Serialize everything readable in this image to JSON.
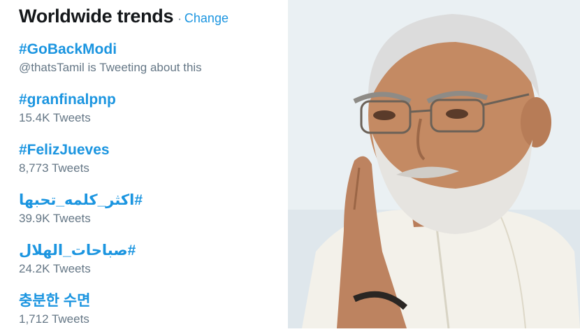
{
  "trends_panel": {
    "title": "Worldwide trends",
    "separator": "·",
    "change_label": "Change",
    "items": [
      {
        "name": "#GoBackModi",
        "meta": "@thatsTamil is Tweeting about this"
      },
      {
        "name": "#granfinalpnp",
        "meta": "15.4K Tweets"
      },
      {
        "name": "#FelizJueves",
        "meta": "8,773 Tweets"
      },
      {
        "name": "#اكثر_كلمه_تحبها",
        "meta": "39.9K Tweets"
      },
      {
        "name": "#صباحات_الهلال",
        "meta": "24.2K Tweets"
      },
      {
        "name": "충분한 수면",
        "meta": "1,712 Tweets"
      }
    ]
  },
  "colors": {
    "link": "#1b95e0",
    "title": "#14171a",
    "meta": "#657786"
  }
}
